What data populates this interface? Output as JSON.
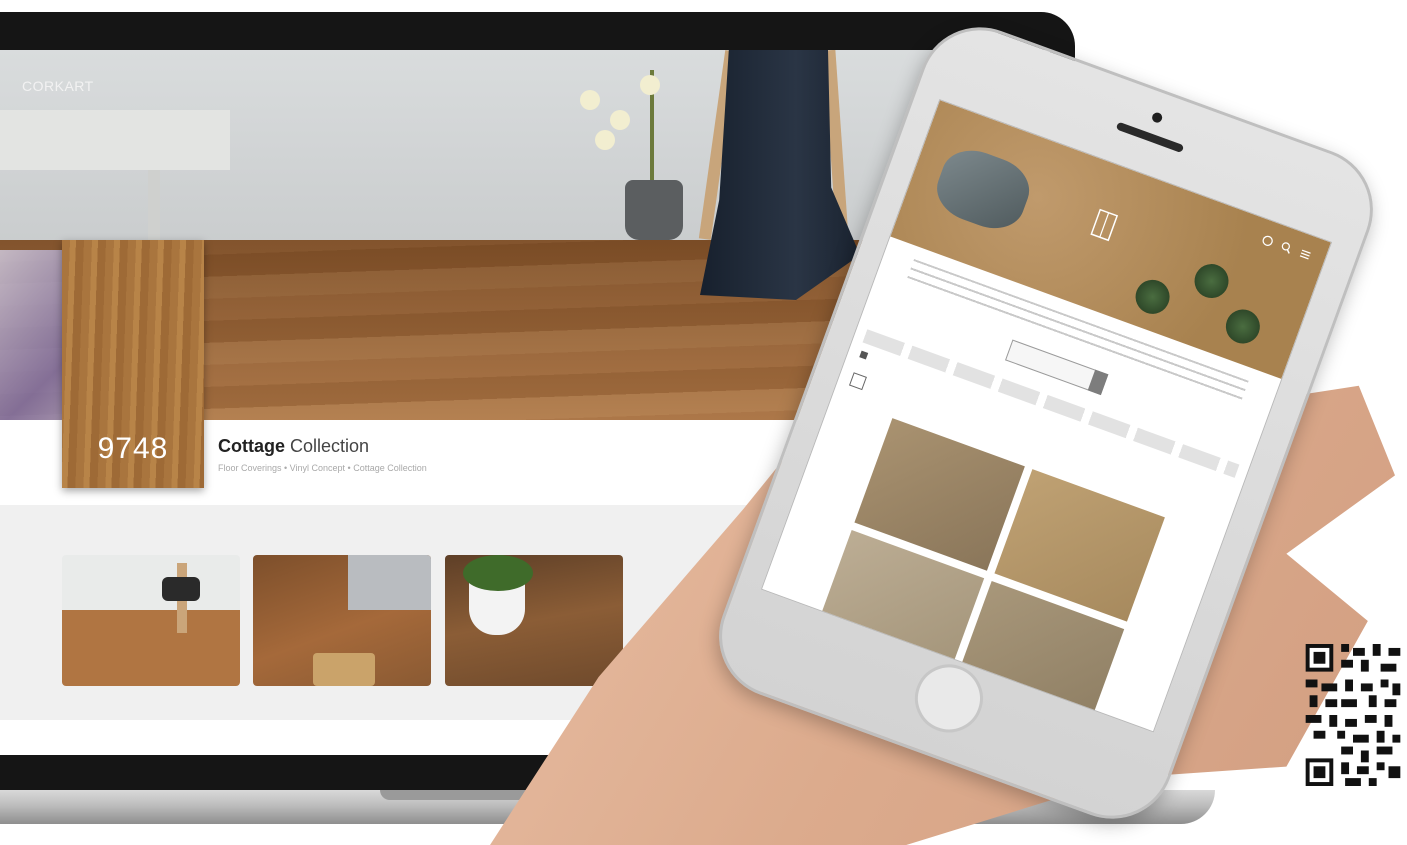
{
  "site": {
    "logo": "CORKART"
  },
  "nav": {
    "icons": [
      "globe-icon",
      "search-icon",
      "menu-icon"
    ]
  },
  "product": {
    "code": "9748",
    "title_bold": "Cottage",
    "title_rest": " Collection",
    "breadcrumb": "Floor Coverings • Vinyl Concept • Cottage Collection"
  },
  "gallery": {
    "thumbs": [
      "living-room-thumb",
      "floor-detail-thumb",
      "plant-thumb"
    ]
  },
  "colors": {
    "wood": "#a9753e",
    "curtain": "#1f2936",
    "phone_body": "#d9d9d9"
  }
}
